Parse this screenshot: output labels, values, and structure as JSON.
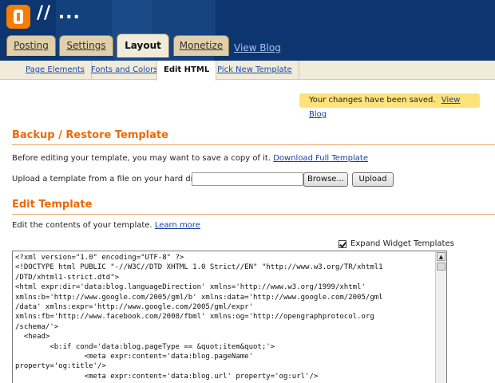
{
  "header": {
    "blog_title": "// ..."
  },
  "main_tabs": [
    {
      "label": "Posting"
    },
    {
      "label": "Settings"
    },
    {
      "label": "Layout"
    },
    {
      "label": "Monetize"
    }
  ],
  "view_blog_tab": "View Blog",
  "sub_tabs": [
    {
      "label": "Page Elements"
    },
    {
      "label": "Fonts and Colors"
    },
    {
      "label": "Edit HTML"
    },
    {
      "label": "Pick New Template"
    }
  ],
  "notice": {
    "text": "Your changes have been saved.",
    "link": "View Blog"
  },
  "backup": {
    "title": "Backup / Restore Template",
    "intro": "Before editing your template, you may want to save a copy of it.",
    "download_link": "Download Full Template",
    "upload_label": "Upload a template from a file on your hard drive:",
    "browse_button": "Browse...",
    "upload_button": "Upload"
  },
  "edit": {
    "title": "Edit Template",
    "intro": "Edit the contents of your template.",
    "learn_more": "Learn more",
    "expand_label": "Expand Widget Templates",
    "code": "<?xml version=\"1.0\" encoding=\"UTF-8\" ?>\n<!DOCTYPE html PUBLIC \"-//W3C//DTD XHTML 1.0 Strict//EN\" \"http://www.w3.org/TR/xhtml1\n/DTD/xhtml1-strict.dtd\">\n<html expr:dir='data:blog.languageDirection' xmlns='http://www.w3.org/1999/xhtml'\nxmlns:b='http://www.google.com/2005/gml/b' xmlns:data='http://www.google.com/2005/gml\n/data' xmlns:expr='http://www.google.com/2005/gml/expr'\nxmlns:fb='http://www.facebook.com/2008/fbml' xmlns:og='http://opengraphprotocol.org\n/schema/'>\n  <head>\n        <b:if cond='data:blog.pageType == &quot;item&quot;'>\n                <meta expr:content='data:blog.pageName'\nproperty='og:title'/>\n                <meta expr:content='data:blog.url' property='og:url'/>"
  }
}
